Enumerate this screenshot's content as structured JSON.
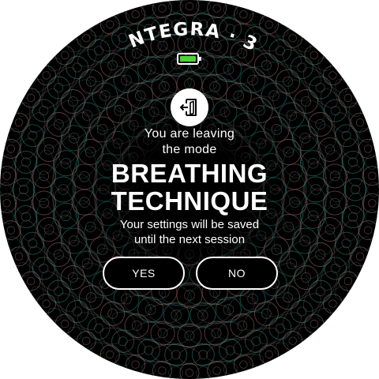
{
  "device": {
    "brand": "INTEGRA",
    "model": "3",
    "battery_level": 1.0,
    "battery_color": "#4cd137"
  },
  "dialog": {
    "icon": "exit-door-icon",
    "line1": "You are leaving",
    "line2": "the mode",
    "mode_line1": "BREATHING",
    "mode_line2": "TECHNIQUE",
    "note_line1": "Your settings will be saved",
    "note_line2": "until the next session",
    "yes_label": "YES",
    "no_label": "NO"
  },
  "colors": {
    "background": "#000000",
    "text": "#ffffff",
    "pattern_teal": "#2f8f84",
    "pattern_rose": "#a8706f"
  }
}
